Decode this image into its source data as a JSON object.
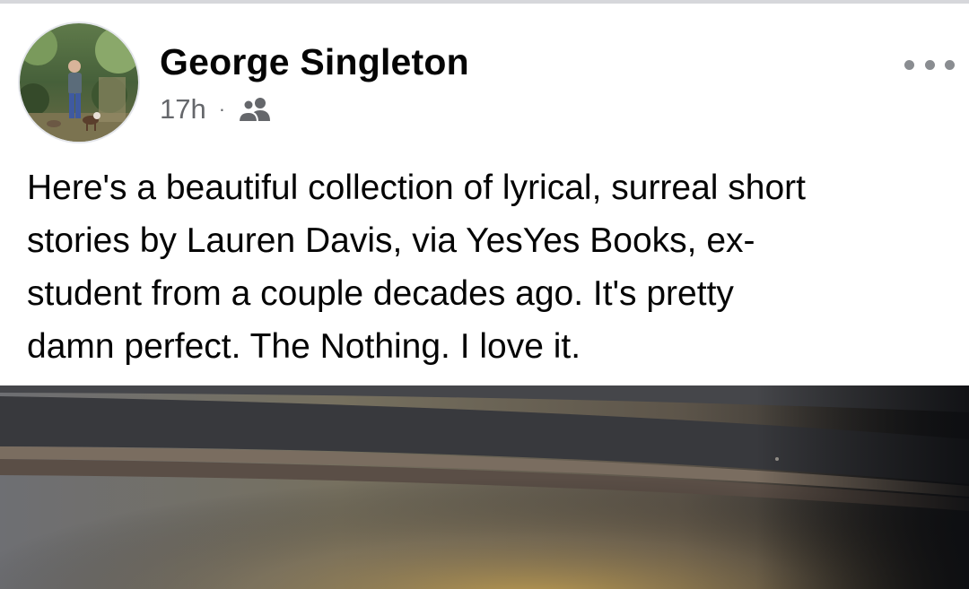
{
  "post": {
    "author": {
      "name": "George Singleton",
      "avatar_icon": "profile-photo"
    },
    "timestamp": "17h",
    "separator": "·",
    "audience_icon": "friends-icon",
    "more_icon": "more-options-icon",
    "text": "Here's a beautiful collection of lyrical, surreal short\nstories by Lauren Davis, via YesYes Books, ex-\nstudent from a couple decades ago. It's pretty\ndamn perfect. The Nothing. I love it.",
    "photo": {
      "description_icon": "post-photo"
    }
  },
  "colors": {
    "name": "#050505",
    "meta": "#65676b",
    "text": "#050505",
    "divider": "#d6d7db"
  }
}
